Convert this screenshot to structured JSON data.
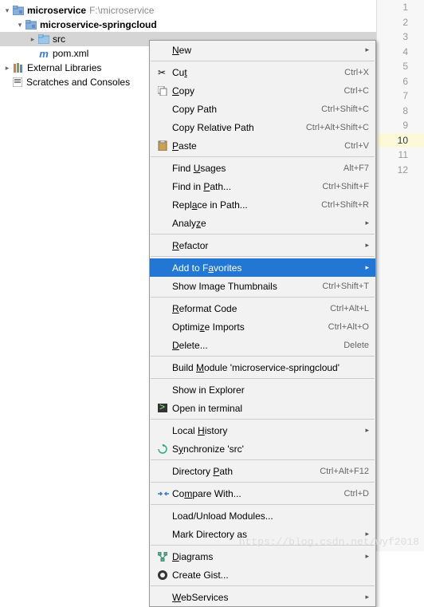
{
  "tree": {
    "root": {
      "name": "microservice",
      "path": "F:\\microservice"
    },
    "child1": "microservice-springcloud",
    "child2": "src",
    "child3": "pom.xml",
    "ext": "External Libraries",
    "scratch": "Scratches and Consoles"
  },
  "gutter": [
    "1",
    "2",
    "3",
    "4",
    "5",
    "6",
    "7",
    "8",
    "9",
    "10",
    "11",
    "12"
  ],
  "gutter_current": 10,
  "menu": {
    "new": "New",
    "cut": {
      "l": "Cut",
      "s": "Ctrl+X"
    },
    "copy": {
      "l": "Copy",
      "s": "Ctrl+C"
    },
    "copypath": {
      "l": "Copy Path",
      "s": "Ctrl+Shift+C"
    },
    "copyrel": {
      "l": "Copy Relative Path",
      "s": "Ctrl+Alt+Shift+C"
    },
    "paste": {
      "l": "Paste",
      "s": "Ctrl+V"
    },
    "findu": {
      "l": "Find Usages",
      "s": "Alt+F7"
    },
    "findp": {
      "l": "Find in Path...",
      "s": "Ctrl+Shift+F"
    },
    "repl": {
      "l": "Replace in Path...",
      "s": "Ctrl+Shift+R"
    },
    "analyze": "Analyze",
    "refactor": "Refactor",
    "fav": "Add to Favorites",
    "thumb": {
      "l": "Show Image Thumbnails",
      "s": "Ctrl+Shift+T"
    },
    "reformat": {
      "l": "Reformat Code",
      "s": "Ctrl+Alt+L"
    },
    "opt": {
      "l": "Optimize Imports",
      "s": "Ctrl+Alt+O"
    },
    "del": {
      "l": "Delete...",
      "s": "Delete"
    },
    "build": "Build Module 'microservice-springcloud'",
    "expl": "Show in Explorer",
    "term": "Open in terminal",
    "hist": "Local History",
    "sync": "Synchronize 'src'",
    "dirp": {
      "l": "Directory Path",
      "s": "Ctrl+Alt+F12"
    },
    "comp": {
      "l": "Compare With...",
      "s": "Ctrl+D"
    },
    "load": "Load/Unload Modules...",
    "mark": "Mark Directory as",
    "diag": "Diagrams",
    "gist": "Create Gist...",
    "web": "WebServices"
  },
  "watermark": "https://blog.csdn.net/wyf2018"
}
